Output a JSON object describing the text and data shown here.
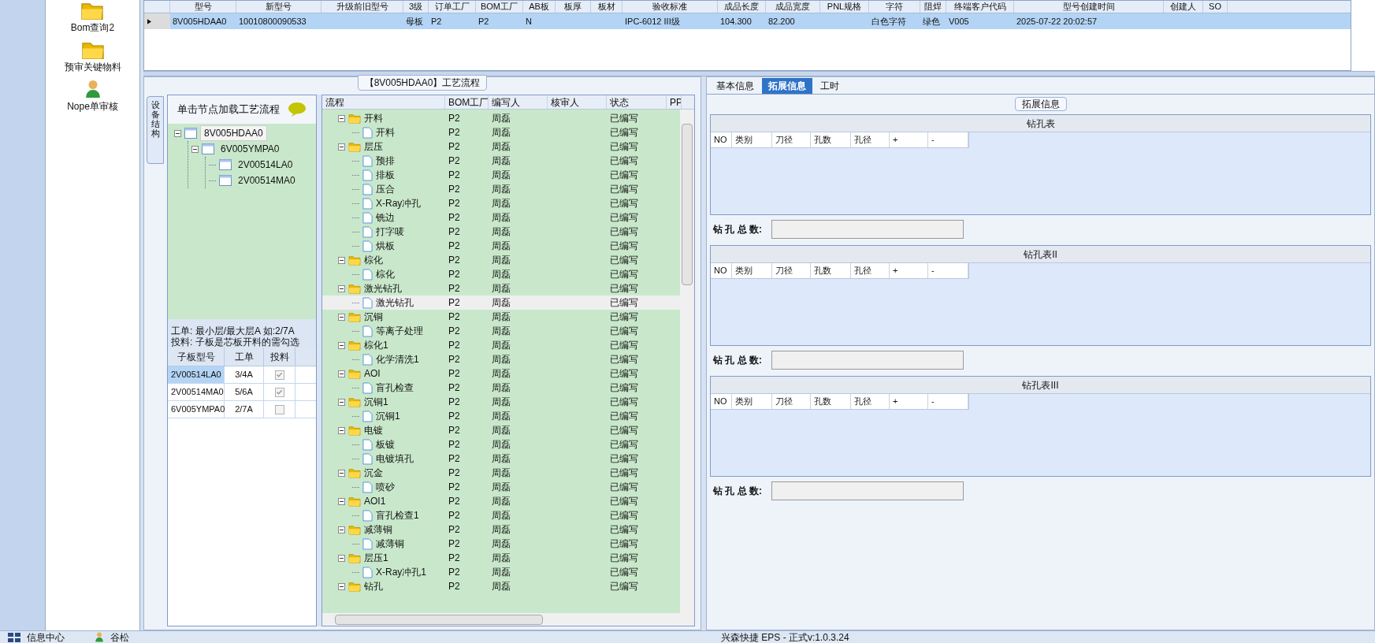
{
  "sidebar": {
    "items": [
      {
        "label": "Bom查询2",
        "kind": "folder"
      },
      {
        "label": "预审关键物料",
        "kind": "folder"
      },
      {
        "label": "Nope单审核",
        "kind": "user"
      }
    ]
  },
  "top_grid": {
    "columns": [
      "型号",
      "新型号",
      "升级前旧型号",
      "3级",
      "订单工厂",
      "BOM工厂",
      "AB板",
      "板厚",
      "板材",
      "验收标准",
      "成品长度",
      "成品宽度",
      "PNL规格",
      "字符",
      "阻焊",
      "终端客户代码",
      "型号创建时间",
      "创建人",
      "SO"
    ],
    "rows": [
      {
        "selected": true,
        "cells": [
          "8V005HDAA0",
          "10010800090533",
          null,
          "母板",
          "P2",
          "P2",
          "N",
          null,
          null,
          "IPC-6012 III级",
          "104.300",
          "82.200",
          null,
          "白色字符",
          "绿色",
          "V005",
          "2025-07-22 20:02:57",
          null,
          null
        ]
      }
    ]
  },
  "process_panel": {
    "title": "【8V005HDAA0】工艺流程",
    "side_tab": "设备结构",
    "structure": {
      "heading": "单击节点加载工艺流程",
      "tree": [
        {
          "label": "8V005HDAA0",
          "expanded": true,
          "selected": true,
          "children": [
            {
              "label": "6V005YMPA0",
              "expanded": true,
              "selected": false,
              "children": [
                {
                  "label": "2V00514LA0",
                  "selected": false
                },
                {
                  "label": "2V00514MA0",
                  "selected": false
                }
              ]
            }
          ]
        }
      ],
      "notes": [
        "工单: 最小层/最大层A 如:2/7A",
        "投料: 子板是芯板开料的需勾选"
      ],
      "sub_boards": {
        "columns": [
          "子板型号",
          "工单",
          "投料"
        ],
        "rows": [
          {
            "model": "2V00514LA0",
            "order": "3/4A",
            "feed": true,
            "selected": true
          },
          {
            "model": "2V00514MA0",
            "order": "5/6A",
            "feed": true,
            "selected": false
          },
          {
            "model": "6V005YMPA0",
            "order": "2/7A",
            "feed": false,
            "selected": false
          }
        ]
      }
    },
    "flow": {
      "columns": [
        "流程",
        "BOM工厂",
        "编写人",
        "核审人",
        "状态",
        "PP"
      ],
      "rows": [
        {
          "label": "开料",
          "kind": "folder",
          "expanded": true,
          "selected": false,
          "factory": "P2",
          "writer": "周磊",
          "status": "已编写",
          "children": [
            {
              "label": "开料",
              "kind": "step",
              "selected": false,
              "factory": "P2",
              "writer": "周磊",
              "status": "已编写"
            }
          ]
        },
        {
          "label": "层压",
          "kind": "folder",
          "expanded": true,
          "selected": false,
          "factory": "P2",
          "writer": "周磊",
          "status": "已编写",
          "children": [
            {
              "label": "预排",
              "kind": "step",
              "selected": false,
              "factory": "P2",
              "writer": "周磊",
              "status": "已编写"
            },
            {
              "label": "排板",
              "kind": "step",
              "selected": false,
              "factory": "P2",
              "writer": "周磊",
              "status": "已编写"
            },
            {
              "label": "压合",
              "kind": "step",
              "selected": false,
              "factory": "P2",
              "writer": "周磊",
              "status": "已编写"
            },
            {
              "label": "X-Ray冲孔",
              "kind": "step",
              "selected": false,
              "factory": "P2",
              "writer": "周磊",
              "status": "已编写"
            },
            {
              "label": "铣边",
              "kind": "step",
              "selected": false,
              "factory": "P2",
              "writer": "周磊",
              "status": "已编写"
            },
            {
              "label": "打字唛",
              "kind": "step",
              "selected": false,
              "factory": "P2",
              "writer": "周磊",
              "status": "已编写"
            },
            {
              "label": "烘板",
              "kind": "step",
              "selected": false,
              "factory": "P2",
              "writer": "周磊",
              "status": "已编写"
            }
          ]
        },
        {
          "label": "棕化",
          "kind": "folder",
          "expanded": true,
          "selected": false,
          "factory": "P2",
          "writer": "周磊",
          "status": "已编写",
          "children": [
            {
              "label": "棕化",
              "kind": "step",
              "selected": false,
              "factory": "P2",
              "writer": "周磊",
              "status": "已编写"
            }
          ]
        },
        {
          "label": "激光钻孔",
          "kind": "folder",
          "expanded": true,
          "selected": false,
          "factory": "P2",
          "writer": "周磊",
          "status": "已编写",
          "children": [
            {
              "label": "激光钻孔",
              "kind": "step",
              "selected": true,
              "factory": "P2",
              "writer": "周磊",
              "status": "已编写"
            }
          ]
        },
        {
          "label": "沉铜",
          "kind": "folder",
          "expanded": true,
          "selected": false,
          "factory": "P2",
          "writer": "周磊",
          "status": "已编写",
          "children": [
            {
              "label": "等离子处理",
              "kind": "step",
              "selected": false,
              "factory": "P2",
              "writer": "周磊",
              "status": "已编写"
            }
          ]
        },
        {
          "label": "棕化1",
          "kind": "folder",
          "expanded": true,
          "selected": false,
          "factory": "P2",
          "writer": "周磊",
          "status": "已编写",
          "children": [
            {
              "label": "化学清洗1",
              "kind": "step",
              "selected": false,
              "factory": "P2",
              "writer": "周磊",
              "status": "已编写"
            }
          ]
        },
        {
          "label": "AOI",
          "kind": "folder",
          "expanded": true,
          "selected": false,
          "factory": "P2",
          "writer": "周磊",
          "status": "已编写",
          "children": [
            {
              "label": "盲孔检查",
              "kind": "step",
              "selected": false,
              "factory": "P2",
              "writer": "周磊",
              "status": "已编写"
            }
          ]
        },
        {
          "label": "沉铜1",
          "kind": "folder",
          "expanded": true,
          "selected": false,
          "factory": "P2",
          "writer": "周磊",
          "status": "已编写",
          "children": [
            {
              "label": "沉铜1",
              "kind": "step",
              "selected": false,
              "factory": "P2",
              "writer": "周磊",
              "status": "已编写"
            }
          ]
        },
        {
          "label": "电镀",
          "kind": "folder",
          "expanded": true,
          "selected": false,
          "factory": "P2",
          "writer": "周磊",
          "status": "已编写",
          "children": [
            {
              "label": "板镀",
              "kind": "step",
              "selected": false,
              "factory": "P2",
              "writer": "周磊",
              "status": "已编写"
            },
            {
              "label": "电镀填孔",
              "kind": "step",
              "selected": false,
              "factory": "P2",
              "writer": "周磊",
              "status": "已编写"
            }
          ]
        },
        {
          "label": "沉金",
          "kind": "folder",
          "expanded": true,
          "selected": false,
          "factory": "P2",
          "writer": "周磊",
          "status": "已编写",
          "children": [
            {
              "label": "喷砂",
              "kind": "step",
              "selected": false,
              "factory": "P2",
              "writer": "周磊",
              "status": "已编写"
            }
          ]
        },
        {
          "label": "AOI1",
          "kind": "folder",
          "expanded": true,
          "selected": false,
          "factory": "P2",
          "writer": "周磊",
          "status": "已编写",
          "children": [
            {
              "label": "盲孔检查1",
              "kind": "step",
              "selected": false,
              "factory": "P2",
              "writer": "周磊",
              "status": "已编写"
            }
          ]
        },
        {
          "label": "减薄铜",
          "kind": "folder",
          "expanded": true,
          "selected": false,
          "factory": "P2",
          "writer": "周磊",
          "status": "已编写",
          "children": [
            {
              "label": "减薄铜",
              "kind": "step",
              "selected": false,
              "factory": "P2",
              "writer": "周磊",
              "status": "已编写"
            }
          ]
        },
        {
          "label": "层压1",
          "kind": "folder",
          "expanded": true,
          "selected": false,
          "factory": "P2",
          "writer": "周磊",
          "status": "已编写",
          "children": [
            {
              "label": "X-Ray冲孔1",
              "kind": "step",
              "selected": false,
              "factory": "P2",
              "writer": "周磊",
              "status": "已编写"
            }
          ]
        },
        {
          "label": "钻孔",
          "kind": "folder",
          "expanded": true,
          "selected": false,
          "factory": "P2",
          "writer": "周磊",
          "status": "已编写"
        }
      ]
    }
  },
  "detail_panel": {
    "tabs": [
      {
        "label": "基本信息",
        "selected": false
      },
      {
        "label": "拓展信息",
        "selected": true
      },
      {
        "label": "工时",
        "selected": false
      }
    ],
    "group_title": "拓展信息",
    "drill_tables": [
      {
        "title": "钻孔表",
        "columns": [
          "NO",
          "类别",
          "刀径",
          "孔数",
          "孔径",
          "+",
          "-"
        ],
        "total_label": "钻 孔 总 数:"
      },
      {
        "title": "钻孔表II",
        "columns": [
          "NO",
          "类别",
          "刀径",
          "孔数",
          "孔径",
          "+",
          "-"
        ],
        "total_label": "钻 孔 总 数:"
      },
      {
        "title": "钻孔表III",
        "columns": [
          "NO",
          "类别",
          "刀径",
          "孔数",
          "孔径",
          "+",
          "-"
        ],
        "total_label": "钻 孔 总 数:"
      }
    ]
  },
  "status_bar": {
    "items": [
      {
        "label": "信息中心",
        "kind": "grid"
      },
      {
        "label": "谷松",
        "kind": "user"
      }
    ],
    "version": "兴森快捷 EPS - 正式v:1.0.3.24"
  }
}
